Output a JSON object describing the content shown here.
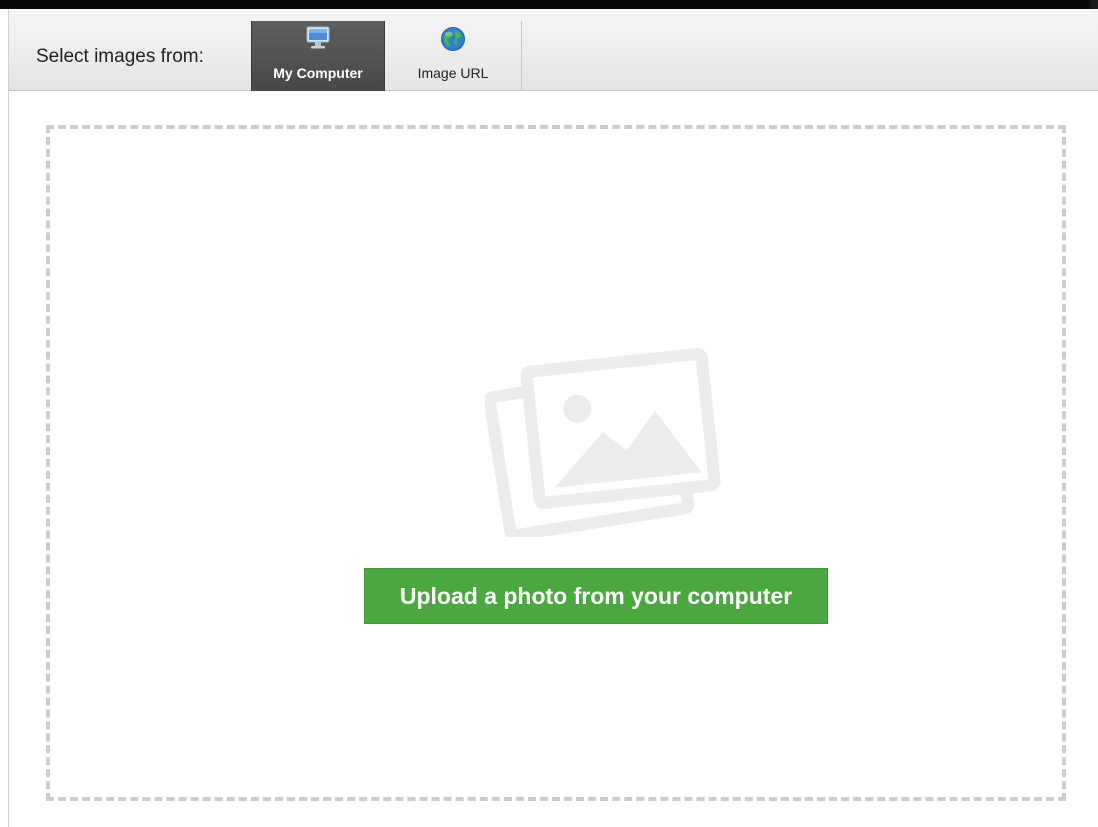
{
  "toolbar": {
    "label": "Select images from:",
    "tabs": [
      {
        "label": "My Computer",
        "icon": "monitor-icon",
        "selected": true
      },
      {
        "label": "Image URL",
        "icon": "globe-icon",
        "selected": false
      }
    ]
  },
  "dropzone": {
    "placeholder_icon": "photo-placeholder-icon",
    "upload_label": "Upload a photo from your computer"
  },
  "colors": {
    "upload_button": "#4aa83f",
    "selected_tab": "#525252",
    "dashed_border": "#cccccc"
  }
}
